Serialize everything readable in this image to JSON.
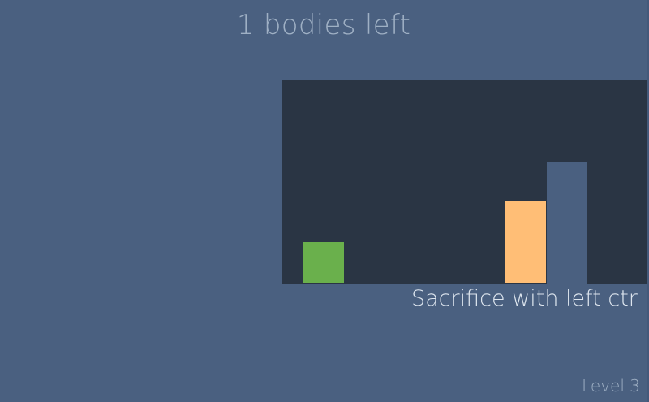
{
  "hud": {
    "bodies_left": "1 bodies left",
    "level": "Level 3"
  },
  "tutorial": {
    "hint": "Sacrifice with left ctr"
  },
  "scene": {
    "entities": [
      {
        "kind": "player",
        "color": "#6ab04c"
      },
      {
        "kind": "crate",
        "color": "#ffbe76"
      },
      {
        "kind": "crate",
        "color": "#ffbe76"
      },
      {
        "kind": "pillar",
        "color": "#4a6080"
      }
    ],
    "colors": {
      "background": "#4a6080",
      "room": "#2a3544",
      "hud_text": "#9fb0c4"
    }
  }
}
